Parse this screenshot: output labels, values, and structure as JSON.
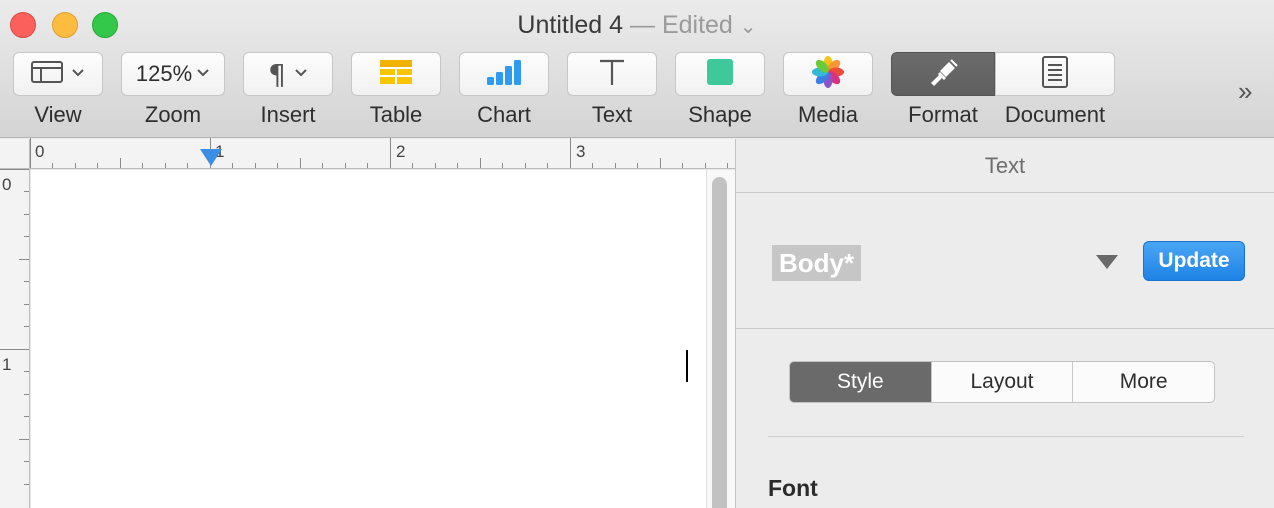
{
  "window": {
    "document_title": "Untitled 4",
    "edited_label": "— Edited",
    "edited_chevron": "⌄"
  },
  "toolbar": {
    "items": [
      {
        "label": "View",
        "icon": "view-icon"
      },
      {
        "label": "Zoom",
        "value": "125%"
      },
      {
        "label": "Insert",
        "icon": "pilcrow-icon"
      },
      {
        "label": "Table",
        "icon": "table-icon"
      },
      {
        "label": "Chart",
        "icon": "chart-icon"
      },
      {
        "label": "Text",
        "icon": "text-icon"
      },
      {
        "label": "Shape",
        "icon": "shape-icon"
      },
      {
        "label": "Media",
        "icon": "media-icon"
      },
      {
        "label": "Format",
        "icon": "paintbrush-icon"
      },
      {
        "label": "Document",
        "icon": "document-icon"
      }
    ],
    "overflow": "»"
  },
  "ruler": {
    "horizontal_numbers": [
      "0",
      "1",
      "2",
      "3"
    ],
    "vertical_numbers": [
      "0",
      "1"
    ]
  },
  "sidebar": {
    "header": "Text",
    "paragraph_style": "Body*",
    "update_label": "Update",
    "tabs": [
      "Style",
      "Layout",
      "More"
    ],
    "active_tab": "Style",
    "font_section": "Font"
  },
  "colors": {
    "accent": "#1f84e6",
    "format_active": "#5f5f5f",
    "indent_marker": "#3b8ee6"
  }
}
